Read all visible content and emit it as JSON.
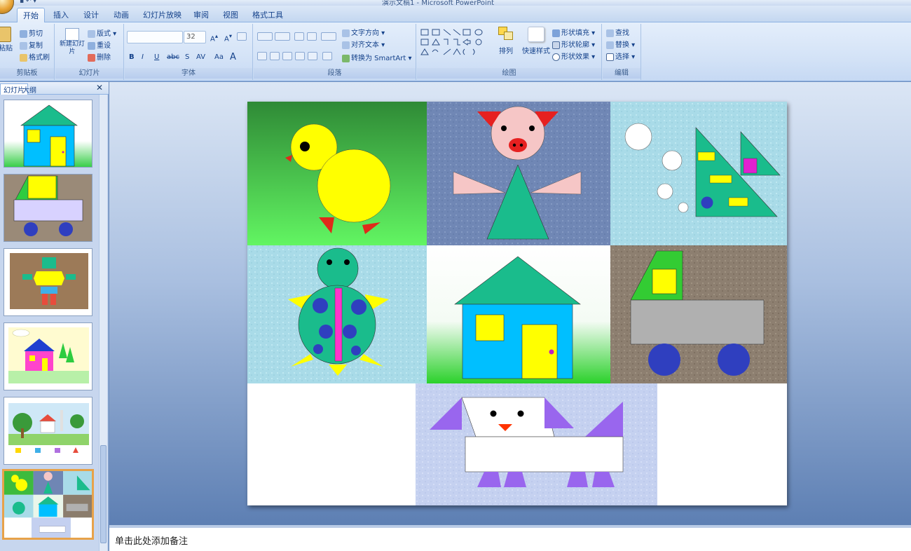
{
  "window": {
    "title": "演示文稿1 - Microsoft PowerPoint"
  },
  "ribbon": {
    "tabs": [
      "开始",
      "插入",
      "设计",
      "动画",
      "幻灯片放映",
      "审阅",
      "视图",
      "格式工具"
    ],
    "clipboard": {
      "paste": "粘贴",
      "cut": "剪切",
      "copy": "复制",
      "format_painter": "格式刷",
      "label": "剪贴板"
    },
    "slides": {
      "new_slide": "新建幻灯片",
      "layout": "版式",
      "reset": "重设",
      "delete": "删除",
      "label": "幻灯片"
    },
    "font": {
      "size": "32",
      "label": "字体"
    },
    "paragraph": {
      "text_direction": "文字方向",
      "align_text": "对齐文本",
      "smartart": "转换为 SmartArt",
      "label": "段落"
    },
    "drawing": {
      "arrange": "排列",
      "quick_styles": "快速样式",
      "shape_fill": "形状填充",
      "shape_outline": "形状轮廓",
      "shape_effects": "形状效果",
      "label": "绘图"
    },
    "editing": {
      "find": "查找",
      "replace": "替换",
      "select": "选择",
      "label": "编辑"
    }
  },
  "left_panel": {
    "tab_slides": "幻灯片",
    "tab_outline": "大纲",
    "selected_index": 6
  },
  "notes": {
    "placeholder": "单击此处添加备注"
  },
  "colors": {
    "ribbon_text": "#15428b",
    "selection": "#e7a24a",
    "teal": "#1abc8c",
    "yellow": "#ffff00",
    "blue": "#2f3fbf"
  }
}
